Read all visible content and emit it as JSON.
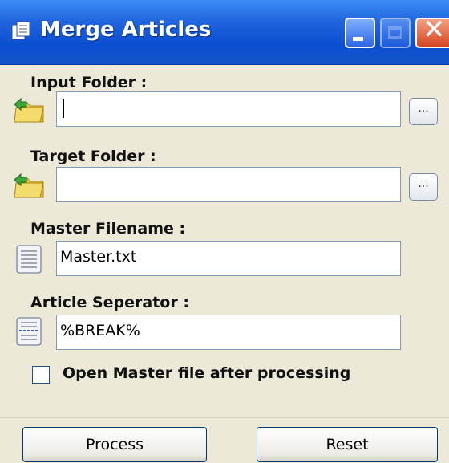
{
  "window": {
    "title": "Merge Articles"
  },
  "input_folder": {
    "label": "Input Folder :",
    "value": "",
    "browse_label": "..."
  },
  "target_folder": {
    "label": "Target Folder :",
    "value": "",
    "browse_label": "..."
  },
  "master_filename": {
    "label": "Master Filename :",
    "value": "Master.txt"
  },
  "article_separator": {
    "label": "Article Seperator :",
    "value": "%BREAK%"
  },
  "open_master": {
    "label": "Open Master file after processing",
    "checked": false
  },
  "buttons": {
    "process": "Process",
    "reset": "Reset"
  },
  "icons": {
    "app": "document-icon",
    "input_folder": "folder-green-arrow-icon",
    "target_folder": "folder-green-arrow-icon",
    "master_filename": "text-file-icon",
    "article_separator": "separator-lines-icon"
  }
}
